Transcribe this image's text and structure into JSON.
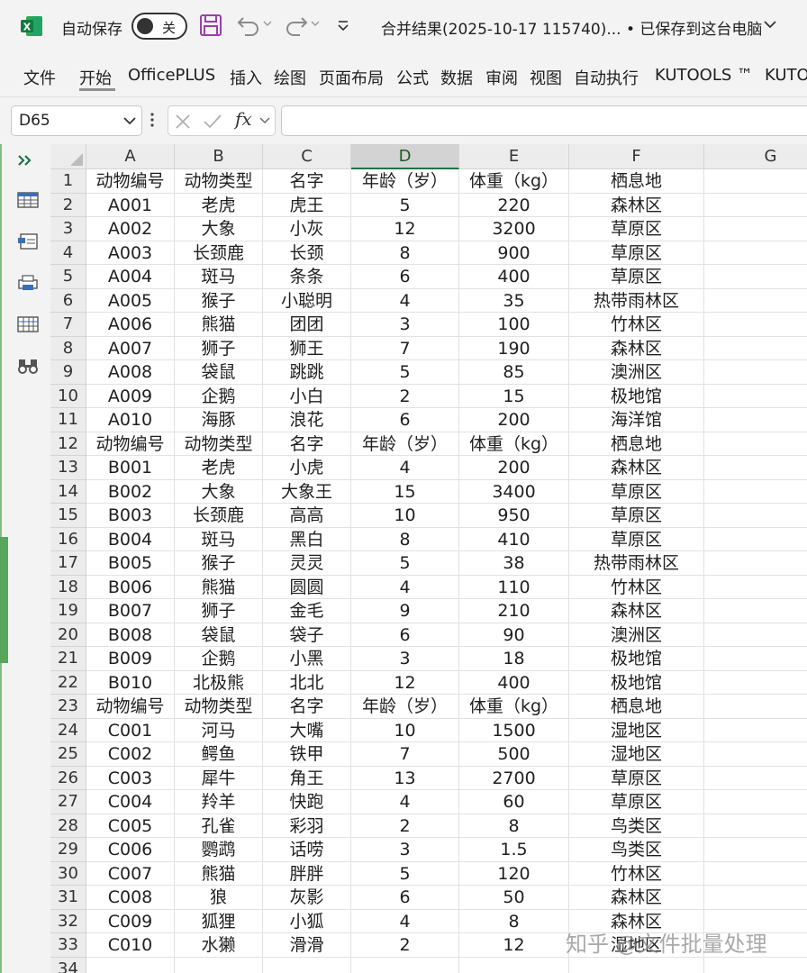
{
  "titlebar": {
    "autosave_label": "自动保存",
    "autosave_state": "关",
    "document_title": "合并结果(2025-10-17 115740)... • 已保存到这台电脑"
  },
  "ribbon": {
    "tabs": [
      "文件",
      "开始",
      "OfficePLUS",
      "插入",
      "绘图",
      "页面布局",
      "公式",
      "数据",
      "审阅",
      "视图",
      "自动执行",
      "KUTOOLS ™",
      "KUTO"
    ]
  },
  "formula_bar": {
    "name_box": "D65",
    "fx": "fx",
    "formula": ""
  },
  "grid": {
    "columns": [
      "A",
      "B",
      "C",
      "D",
      "E",
      "F",
      "G"
    ],
    "selected_column": "D",
    "rows": [
      [
        "1",
        "动物编号",
        "动物类型",
        "名字",
        "年龄（岁）",
        "体重（kg）",
        "栖息地",
        ""
      ],
      [
        "2",
        "A001",
        "老虎",
        "虎王",
        "5",
        "220",
        "森林区",
        ""
      ],
      [
        "3",
        "A002",
        "大象",
        "小灰",
        "12",
        "3200",
        "草原区",
        ""
      ],
      [
        "4",
        "A003",
        "长颈鹿",
        "长颈",
        "8",
        "900",
        "草原区",
        ""
      ],
      [
        "5",
        "A004",
        "斑马",
        "条条",
        "6",
        "400",
        "草原区",
        ""
      ],
      [
        "6",
        "A005",
        "猴子",
        "小聪明",
        "4",
        "35",
        "热带雨林区",
        ""
      ],
      [
        "7",
        "A006",
        "熊猫",
        "团团",
        "3",
        "100",
        "竹林区",
        ""
      ],
      [
        "8",
        "A007",
        "狮子",
        "狮王",
        "7",
        "190",
        "森林区",
        ""
      ],
      [
        "9",
        "A008",
        "袋鼠",
        "跳跳",
        "5",
        "85",
        "澳洲区",
        ""
      ],
      [
        "10",
        "A009",
        "企鹅",
        "小白",
        "2",
        "15",
        "极地馆",
        ""
      ],
      [
        "11",
        "A010",
        "海豚",
        "浪花",
        "6",
        "200",
        "海洋馆",
        ""
      ],
      [
        "12",
        "动物编号",
        "动物类型",
        "名字",
        "年龄（岁）",
        "体重（kg）",
        "栖息地",
        ""
      ],
      [
        "13",
        "B001",
        "老虎",
        "小虎",
        "4",
        "200",
        "森林区",
        ""
      ],
      [
        "14",
        "B002",
        "大象",
        "大象王",
        "15",
        "3400",
        "草原区",
        ""
      ],
      [
        "15",
        "B003",
        "长颈鹿",
        "高高",
        "10",
        "950",
        "草原区",
        ""
      ],
      [
        "16",
        "B004",
        "斑马",
        "黑白",
        "8",
        "410",
        "草原区",
        ""
      ],
      [
        "17",
        "B005",
        "猴子",
        "灵灵",
        "5",
        "38",
        "热带雨林区",
        ""
      ],
      [
        "18",
        "B006",
        "熊猫",
        "圆圆",
        "4",
        "110",
        "竹林区",
        ""
      ],
      [
        "19",
        "B007",
        "狮子",
        "金毛",
        "9",
        "210",
        "森林区",
        ""
      ],
      [
        "20",
        "B008",
        "袋鼠",
        "袋子",
        "6",
        "90",
        "澳洲区",
        ""
      ],
      [
        "21",
        "B009",
        "企鹅",
        "小黑",
        "3",
        "18",
        "极地馆",
        ""
      ],
      [
        "22",
        "B010",
        "北极熊",
        "北北",
        "12",
        "400",
        "极地馆",
        ""
      ],
      [
        "23",
        "动物编号",
        "动物类型",
        "名字",
        "年龄（岁）",
        "体重（kg）",
        "栖息地",
        ""
      ],
      [
        "24",
        "C001",
        "河马",
        "大嘴",
        "10",
        "1500",
        "湿地区",
        ""
      ],
      [
        "25",
        "C002",
        "鳄鱼",
        "铁甲",
        "7",
        "500",
        "湿地区",
        ""
      ],
      [
        "26",
        "C003",
        "犀牛",
        "角王",
        "13",
        "2700",
        "草原区",
        ""
      ],
      [
        "27",
        "C004",
        "羚羊",
        "快跑",
        "4",
        "60",
        "草原区",
        ""
      ],
      [
        "28",
        "C005",
        "孔雀",
        "彩羽",
        "2",
        "8",
        "鸟类区",
        ""
      ],
      [
        "29",
        "C006",
        "鹦鹉",
        "话唠",
        "3",
        "1.5",
        "鸟类区",
        ""
      ],
      [
        "30",
        "C007",
        "熊猫",
        "胖胖",
        "5",
        "120",
        "竹林区",
        ""
      ],
      [
        "31",
        "C008",
        "狼",
        "灰影",
        "6",
        "50",
        "森林区",
        ""
      ],
      [
        "32",
        "C009",
        "狐狸",
        "小狐",
        "4",
        "8",
        "森林区",
        ""
      ],
      [
        "33",
        "C010",
        "水獭",
        "滑滑",
        "2",
        "12",
        "湿地区",
        ""
      ],
      [
        "34",
        "",
        "",
        "",
        "",
        "",
        "",
        ""
      ]
    ]
  },
  "watermark": "知乎 @文件批量处理",
  "colors": {
    "excel_green": "#217346",
    "accent_green": "#58a65c",
    "save_purple": "#9b3fa8"
  },
  "icons": [
    "excel-logo-icon",
    "save-icon",
    "undo-icon",
    "redo-icon",
    "customize-qat-icon",
    "expand-panel-icon",
    "table-icon",
    "form-icon",
    "print-icon",
    "grid-icon",
    "find-icon"
  ]
}
